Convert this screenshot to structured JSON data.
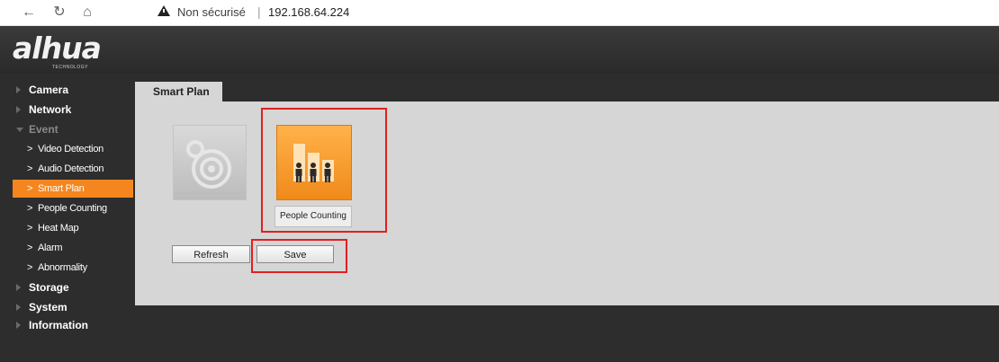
{
  "browser": {
    "security_label": "Non sécurisé",
    "separator": "|",
    "url": "192.168.64.224"
  },
  "logo": {
    "text": "alhua",
    "subtext": "TECHNOLOGY"
  },
  "sidebar": {
    "items": [
      {
        "label": "Camera",
        "level": "top"
      },
      {
        "label": "Network",
        "level": "top"
      },
      {
        "label": "Event",
        "level": "top",
        "expanded": true
      },
      {
        "label": "Video Detection",
        "level": "sub"
      },
      {
        "label": "Audio Detection",
        "level": "sub"
      },
      {
        "label": "Smart Plan",
        "level": "sub",
        "active": true
      },
      {
        "label": "People Counting",
        "level": "sub"
      },
      {
        "label": "Heat Map",
        "level": "sub"
      },
      {
        "label": "Alarm",
        "level": "sub"
      },
      {
        "label": "Abnormality",
        "level": "sub"
      },
      {
        "label": "Storage",
        "level": "top"
      },
      {
        "label": "System",
        "level": "top"
      },
      {
        "label": "Information",
        "level": "top"
      }
    ]
  },
  "main": {
    "tab_label": "Smart Plan",
    "tiles": [
      {
        "icon": "camera-lens-icon",
        "label": "",
        "selected": false
      },
      {
        "icon": "people-counting-icon",
        "label": "People Counting",
        "selected": true
      }
    ],
    "buttons": {
      "refresh": "Refresh",
      "save": "Save"
    }
  },
  "colors": {
    "accent": "#f5861f",
    "highlight_border": "#e02020",
    "panel": "#d6d6d6",
    "background": "#2d2d2d"
  }
}
